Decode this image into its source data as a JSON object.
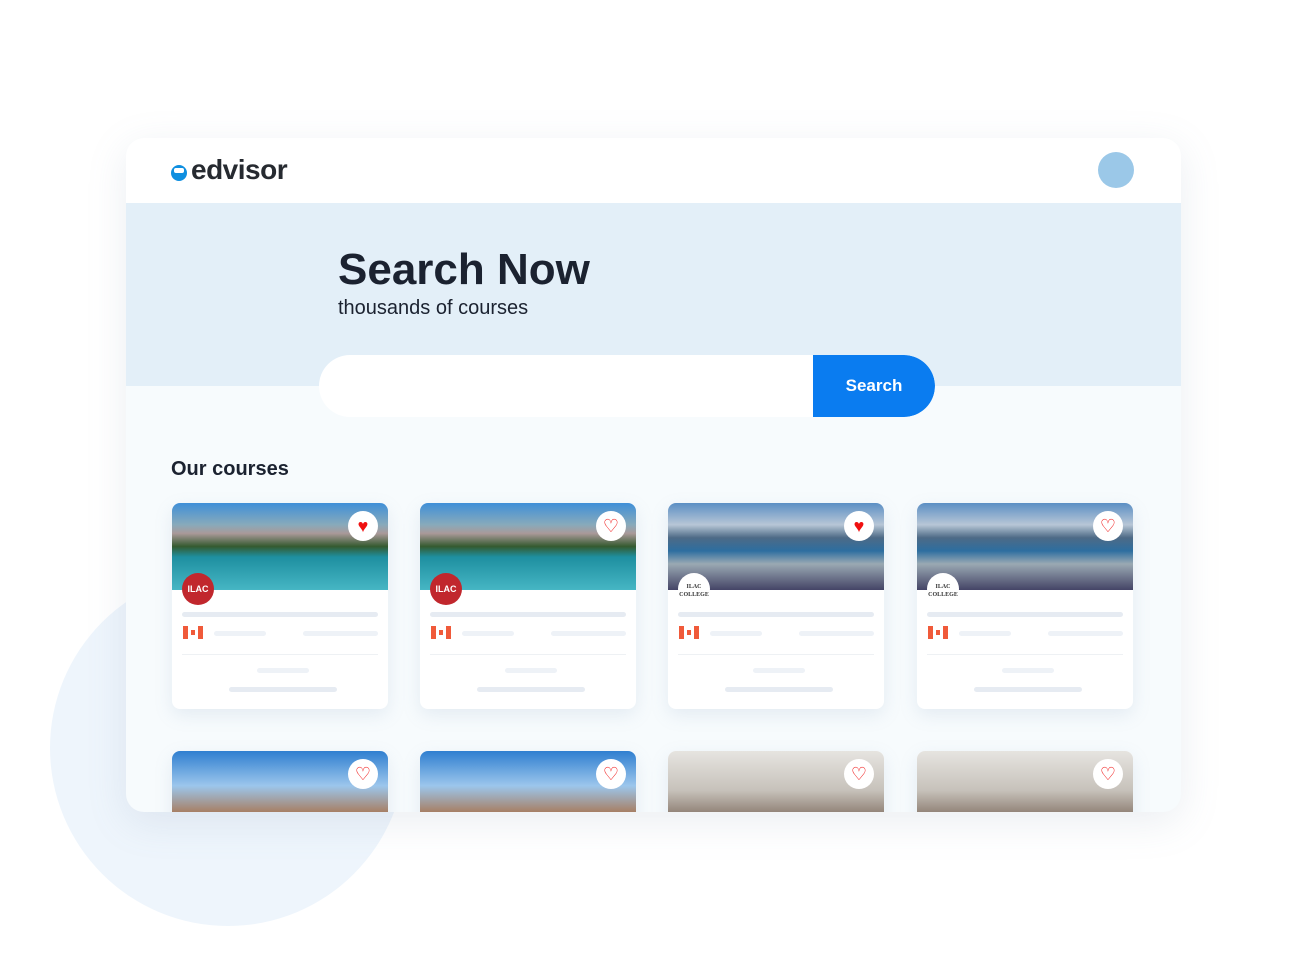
{
  "brand": {
    "name": "edvisor",
    "accent": "#0a7cf0"
  },
  "hero": {
    "title": "Search Now",
    "subtitle": "thousands of courses"
  },
  "search": {
    "placeholder": "",
    "value": "",
    "button": "Search"
  },
  "courses": {
    "heading": "Our courses",
    "cards": [
      {
        "image": "lake",
        "school": "ILAC",
        "favorited": true,
        "flag": "canada"
      },
      {
        "image": "lake",
        "school": "ILAC",
        "favorited": false,
        "flag": "canada"
      },
      {
        "image": "city",
        "school": "ILAC COLLEGE",
        "favorited": true,
        "flag": "canada"
      },
      {
        "image": "city",
        "school": "ILAC COLLEGE",
        "favorited": false,
        "flag": "canada"
      },
      {
        "image": "chateau",
        "favorited": false
      },
      {
        "image": "chateau",
        "favorited": false
      },
      {
        "image": "tor",
        "favorited": false
      },
      {
        "image": "tor",
        "favorited": false
      }
    ]
  }
}
